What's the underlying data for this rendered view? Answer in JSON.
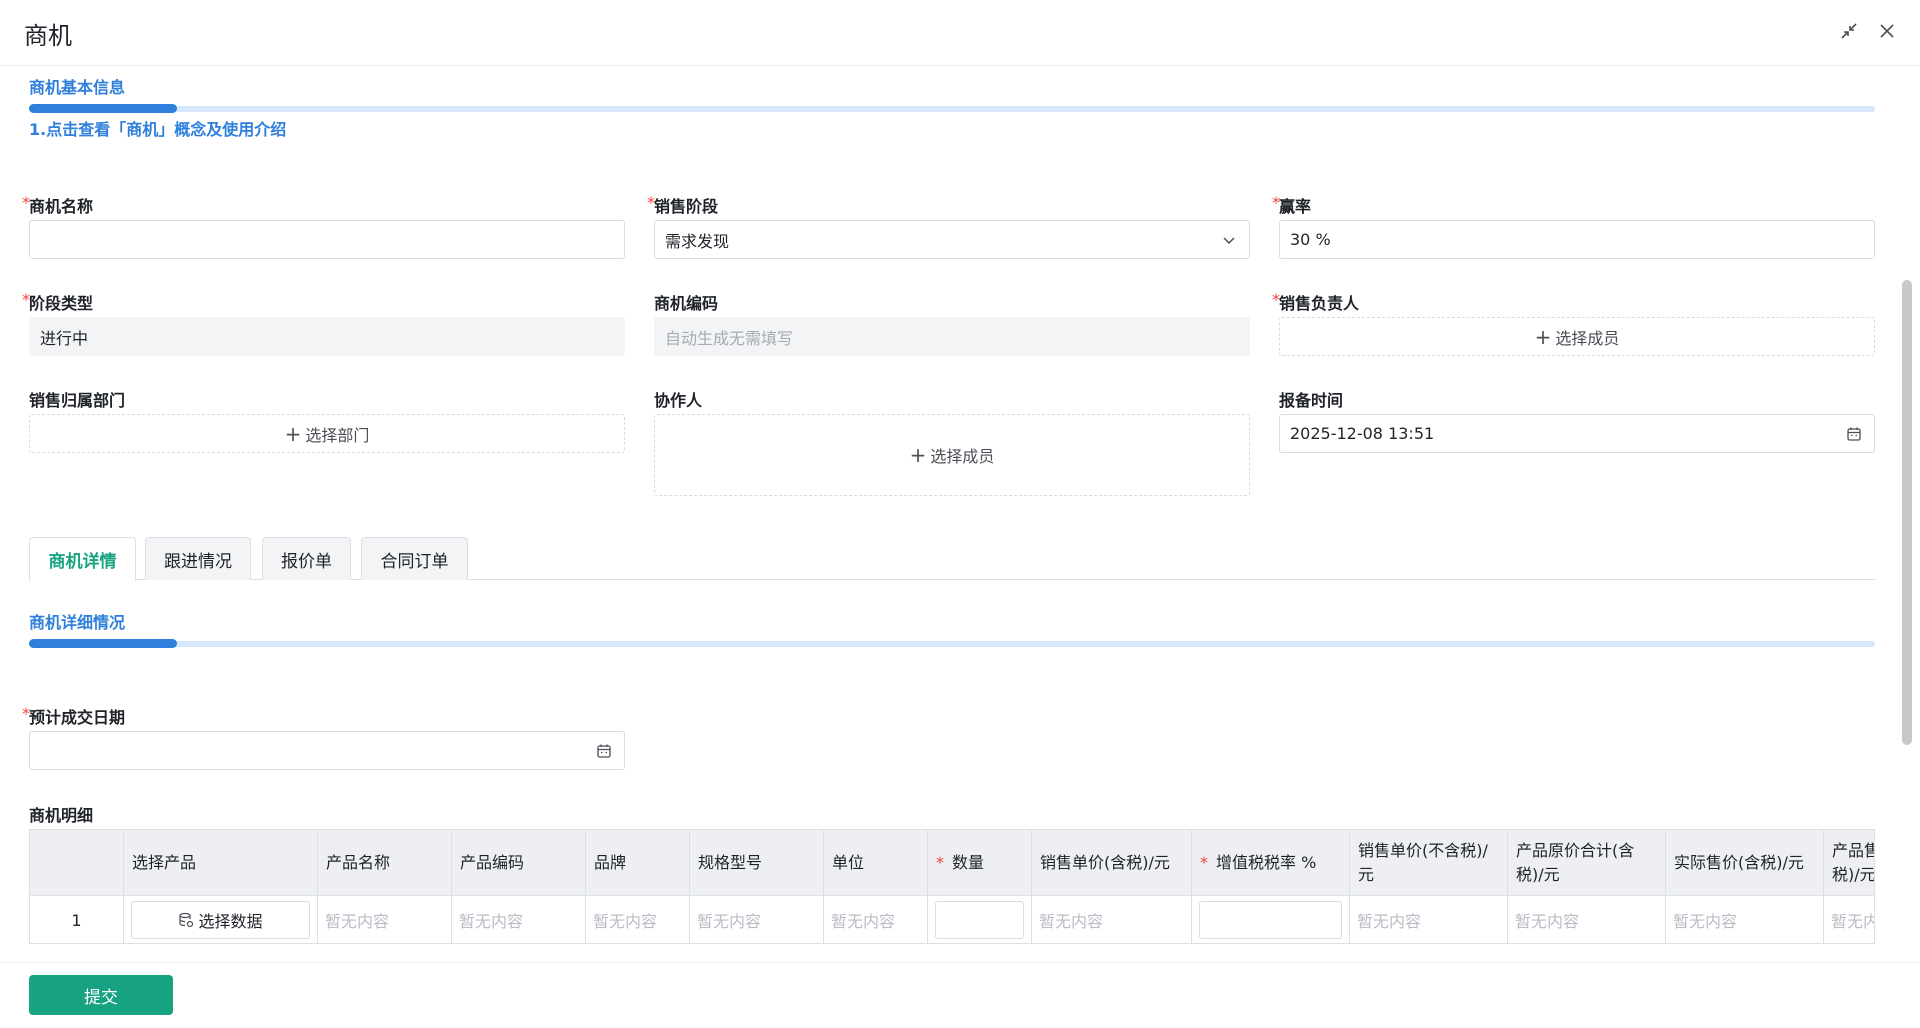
{
  "header": {
    "title": "商机"
  },
  "basic": {
    "section_title": "商机基本信息",
    "intro_link": "1.点击查看「商机」概念及使用介绍"
  },
  "fields": {
    "name": {
      "label": "商机名称",
      "value": ""
    },
    "stage": {
      "label": "销售阶段",
      "value": "需求发现"
    },
    "win_rate": {
      "label": "赢率",
      "value": "30 %"
    },
    "stage_type": {
      "label": "阶段类型",
      "value": "进行中"
    },
    "code": {
      "label": "商机编码",
      "placeholder": "自动生成无需填写"
    },
    "owner": {
      "label": "销售负责人",
      "button": "选择成员"
    },
    "dept": {
      "label": "销售归属部门",
      "button": "选择部门"
    },
    "collaborator": {
      "label": "协作人",
      "button": "选择成员"
    },
    "report_time": {
      "label": "报备时间",
      "value": "2025-12-08 13:51"
    }
  },
  "tabs": [
    {
      "label": "商机详情"
    },
    {
      "label": "跟进情况"
    },
    {
      "label": "报价单"
    },
    {
      "label": "合同订单"
    }
  ],
  "detail": {
    "section_title": "商机详细情况",
    "close_date": {
      "label": "预计成交日期",
      "value": ""
    },
    "lines_label": "商机明细"
  },
  "table": {
    "headers": [
      {
        "label": ""
      },
      {
        "label": "选择产品"
      },
      {
        "label": "产品名称"
      },
      {
        "label": "产品编码"
      },
      {
        "label": "品牌"
      },
      {
        "label": "规格型号"
      },
      {
        "label": "单位"
      },
      {
        "label": "数量",
        "required": true
      },
      {
        "label": "销售单价(含税)/元"
      },
      {
        "label": "增值税税率 %",
        "required": true
      },
      {
        "label": "销售单价(不含税)/元"
      },
      {
        "label": "产品原价合计(含税)/元"
      },
      {
        "label": "实际售价(含税)/元"
      },
      {
        "label": "产品售价合计(含税)/元"
      }
    ],
    "rows": [
      {
        "index": "1",
        "select_button": "选择数据",
        "empty_text": "暂无内容"
      }
    ]
  },
  "footer": {
    "submit": "提交"
  },
  "colors": {
    "accent_blue": "#2f7fdc",
    "primary_green": "#17a382",
    "required_red": "#f2463a"
  }
}
